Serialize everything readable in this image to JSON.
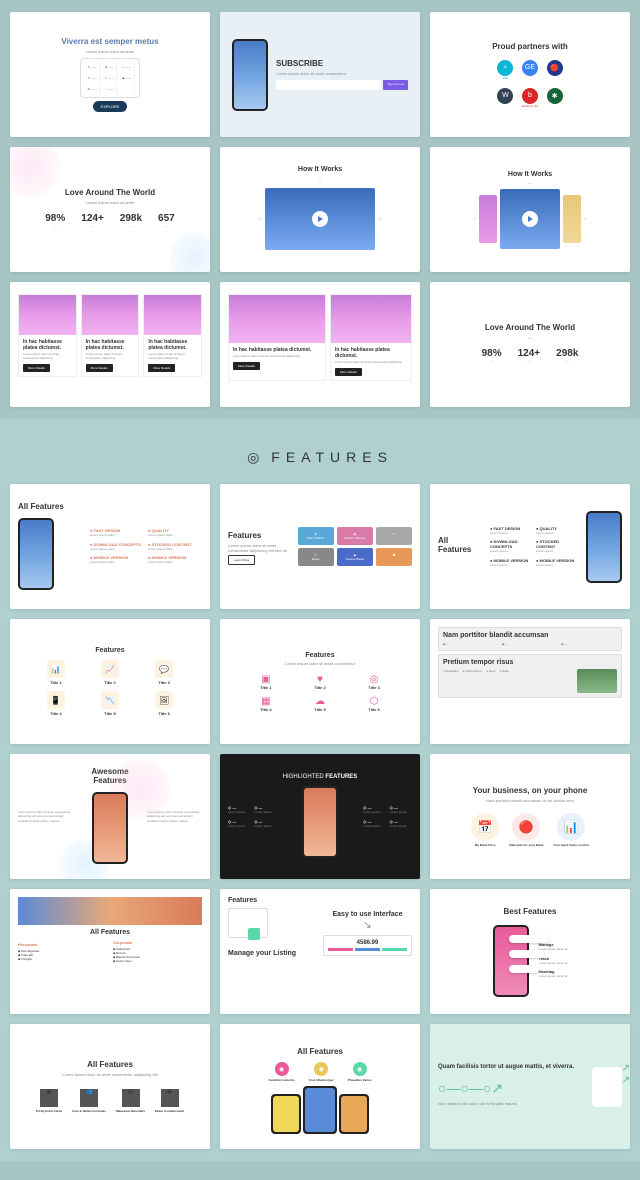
{
  "section_title": "FEATURES",
  "row1": {
    "slide1": {
      "title": "Viverra est semper metus",
      "btn": "EXPLORE"
    },
    "slide2": {
      "title": "SUBSCRIBE",
      "sub": "Lorem ipsum dolor sit amet consectetur",
      "btn": "Sign up now"
    },
    "slide3": {
      "title": "Proud partners with",
      "logos": [
        "at&t",
        "GE",
        "NASA",
        "W",
        "b",
        "✱"
      ]
    }
  },
  "row2": {
    "slide1": {
      "title": "Love Around The World",
      "stats": [
        {
          "n": "98%",
          "l": ""
        },
        {
          "n": "124+",
          "l": ""
        },
        {
          "n": "298k",
          "l": ""
        },
        {
          "n": "657",
          "l": ""
        }
      ]
    },
    "slide2": {
      "title": "How It Works"
    },
    "slide3": {
      "title": "How It Works"
    }
  },
  "row3": {
    "card_title": "In hac habitasse platea dictumst.",
    "card_text": "Lorem ipsum dolor sit amet consectetur adipiscing",
    "card_btn": "More Details",
    "slide3": {
      "title": "Love Around The World",
      "stats": [
        {
          "n": "98%",
          "l": ""
        },
        {
          "n": "124+",
          "l": ""
        },
        {
          "n": "298k",
          "l": ""
        }
      ]
    }
  },
  "f1": {
    "s1": {
      "title": "All Features",
      "items": [
        "FAST DESIGN",
        "QUALITY",
        "DOWNLOAD CONCEPTS",
        "STOCKED CONTENT",
        "MOBILE VERSION",
        "MOBILE VERSION"
      ]
    },
    "s2": {
      "title": "Features",
      "btn": "Learn More",
      "boxes": [
        "Nam Porttitor",
        "Pretium Tempor",
        "",
        "Risus",
        "Viverra Platea",
        ""
      ]
    },
    "s3": {
      "title": "All Features",
      "items": [
        "FAST DESIGN",
        "QUALITY",
        "DOWNLOAD CONCEPTS",
        "STOCKED CONTENT",
        "MOBILE VERSION",
        "MOBILE VERSION"
      ]
    }
  },
  "f2": {
    "s1": {
      "title": "Features",
      "titles": [
        "Title 1",
        "Title 2",
        "Title 3",
        "Title 4",
        "Title 5",
        "Title 6"
      ]
    },
    "s2": {
      "title": "Features",
      "titles": [
        "Title 1",
        "Title 2",
        "Title 3",
        "Title 4",
        "Title 5",
        "Title 6"
      ]
    },
    "s3": {
      "title1": "Nam porttitor blandit accumsan",
      "title2": "Pretium tempor risus",
      "items": [
        "Phasellus",
        "Morbi lipsum",
        "Nam",
        "Diam"
      ]
    }
  },
  "f3": {
    "s1": {
      "title": "Awesome Features"
    },
    "s2": {
      "title": "HIGHLIGHTED FEATURES"
    },
    "s3": {
      "title": "Your business, on your phone",
      "items": [
        "My Band Fix is",
        "Data plan for your Band",
        "Your band tracks control"
      ]
    }
  },
  "f4": {
    "s1": {
      "title": "All Features",
      "col1": "Personals",
      "col2": "Corporate",
      "items": [
        "Nam Egestas",
        "Kalirshoka",
        "Vitae Elit",
        "Rutrum",
        "Fringilla",
        "Blandit Accumsan",
        "Nulum Sem"
      ]
    },
    "s2": {
      "title": "Features",
      "h1": "Easy to use Interface",
      "h2": "Manage your Listing",
      "price": "4586.99"
    },
    "s3": {
      "title": "Best Features",
      "items": [
        "Manage",
        "Track",
        "Hashtag"
      ]
    }
  },
  "f5": {
    "s1": {
      "title": "All Features",
      "items": [
        "Pretty Extra Cards",
        "Cras In Nulla Commodo",
        "Maecenas Bibendus",
        "Etiam Condimentum"
      ]
    },
    "s2": {
      "title": "All Features",
      "items": [
        "Curabitur Lobortis",
        "Cras Ullamcorper",
        "Phasellus Varius"
      ]
    },
    "s3": {
      "title": "Quam facilisis tortor ut augue mattis, et viverra."
    }
  }
}
